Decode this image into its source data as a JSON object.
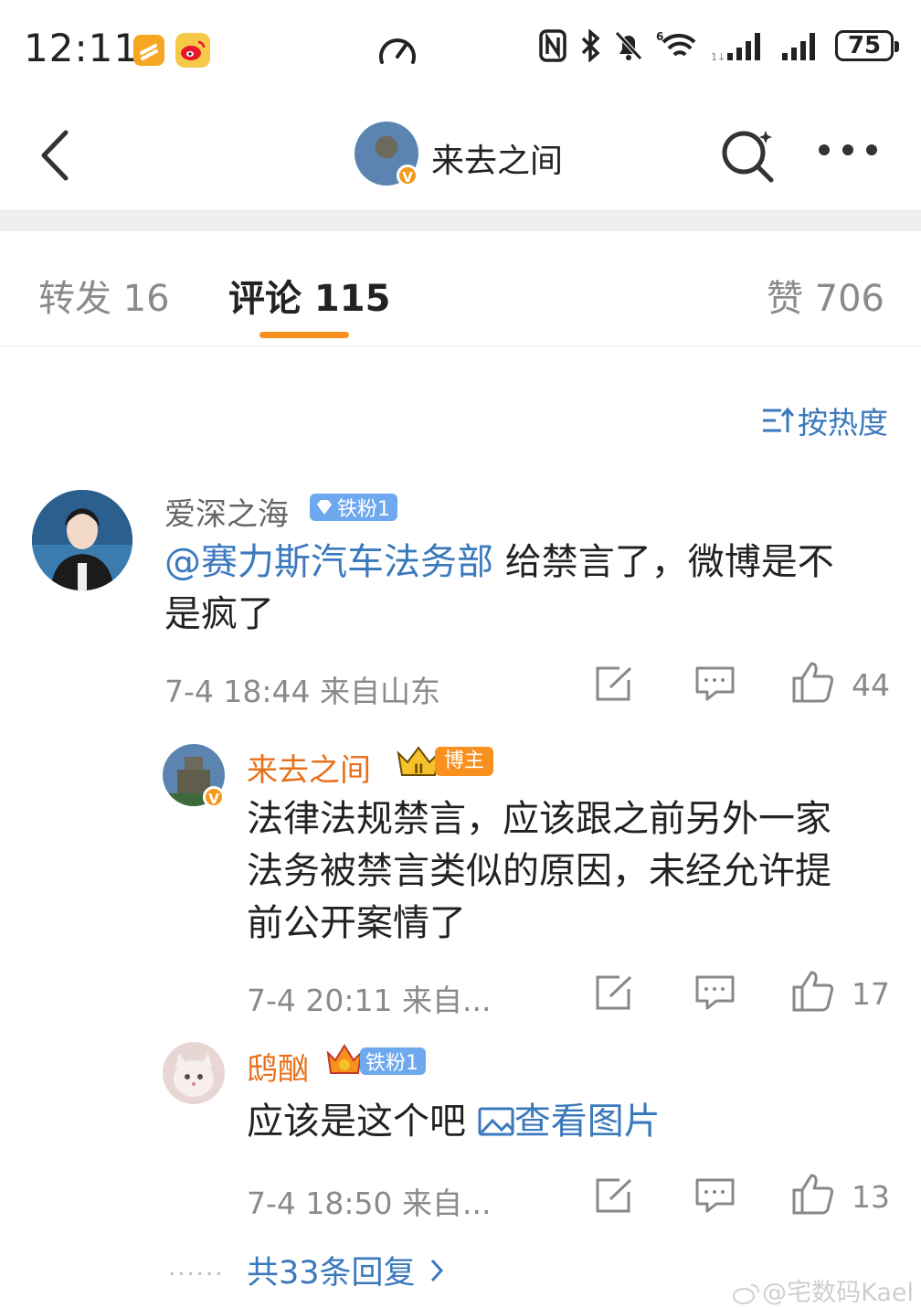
{
  "status_bar": {
    "time": "12:11",
    "battery": "75",
    "icons": [
      "taobao-app-icon",
      "weibo-app-icon",
      "speed-gauge-icon",
      "nfc-icon",
      "bluetooth-icon",
      "mute-bell-icon",
      "wifi-6-icon",
      "signal-icon",
      "signal-icon",
      "battery-icon"
    ]
  },
  "header": {
    "title": "来去之间",
    "verified": "V"
  },
  "tabs": {
    "repost": "转发 16",
    "comment": "评论 115",
    "like": "赞 706"
  },
  "sort": {
    "label": "按热度"
  },
  "comments": [
    {
      "name": "爱深之海",
      "badge": "铁粉1",
      "mention": "@赛力斯汽车法务部",
      "text_line1": " 给禁言了，微博是不",
      "text_line2": "是疯了",
      "meta": "7-4 18:44 来自山东",
      "likes": "44"
    }
  ],
  "replies": [
    {
      "name": "来去之间",
      "badge": "博主",
      "text_line1": "法律法规禁言，应该跟之前另外一家",
      "text_line2": "法务被禁言类似的原因，未经允许提",
      "text_line3": "前公开案情了",
      "meta": "7-4 20:11 来自...",
      "likes": "17"
    },
    {
      "name": "鸱酗",
      "badge": "铁粉1",
      "text": "应该是这个吧 ",
      "image_link": "查看图片",
      "meta": "7-4 18:50 来自...",
      "likes": "13"
    }
  ],
  "more_replies": {
    "dots": "......",
    "label": "共33条回复"
  },
  "watermark": "@宅数码Kael",
  "colors": {
    "accent_orange": "#f7901e",
    "link_blue": "#3b79bd",
    "fan_badge": "#6ea8ef"
  }
}
